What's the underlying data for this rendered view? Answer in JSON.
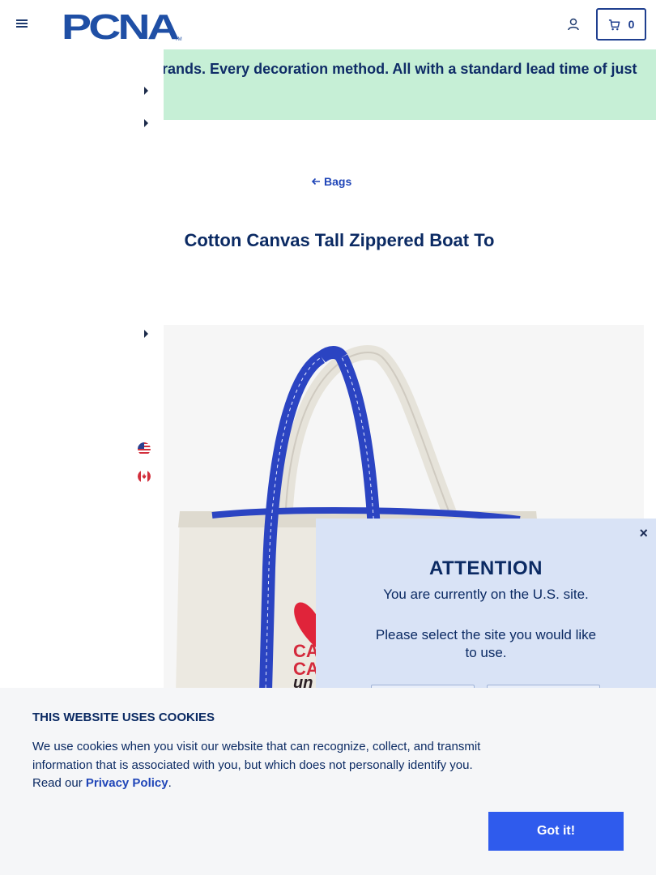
{
  "header": {
    "logo_text": "PCNA",
    "logo_tm": "TM",
    "cart_count": "0"
  },
  "banner": {
    "text": "Thousands of products. Dozens of retail brands. Every decoration method. All with a standard lead time of just five business days."
  },
  "breadcrumb": {
    "back_label": "Bags"
  },
  "product": {
    "title": "Cotton Canvas Tall Zippered Boat Tote",
    "imprint_lines": [
      "CA",
      "CA",
      "un"
    ]
  },
  "site_modal": {
    "close_label": "×",
    "heading": "ATTENTION",
    "message_current": "You are currently on the U.S. site.",
    "message_select": "Please select the site you would like to use."
  },
  "cookie_banner": {
    "heading": "THIS WEBSITE USES COOKIES",
    "body": "We use cookies when you visit our website that can recognize, collect, and transmit information that is associated with you, but which does not personally identify you. Read our ",
    "policy_link": "Privacy Policy",
    "body_end": ".",
    "accept_label": "Got it!"
  },
  "colors": {
    "brand_navy": "#0b2a63",
    "brand_blue": "#2046b8",
    "banner_green": "#c6efd6",
    "button_blue": "#2f5bed",
    "modal_bg": "#d9e3f6",
    "tote_strap": "#2b44c2",
    "tote_canvas": "#ece9e1"
  },
  "icons": [
    "menu-icon",
    "account-icon",
    "cart-icon",
    "arrow-left-icon",
    "caret-right-icon",
    "us-flag-icon",
    "canada-flag-icon",
    "close-icon",
    "heart-icon"
  ]
}
